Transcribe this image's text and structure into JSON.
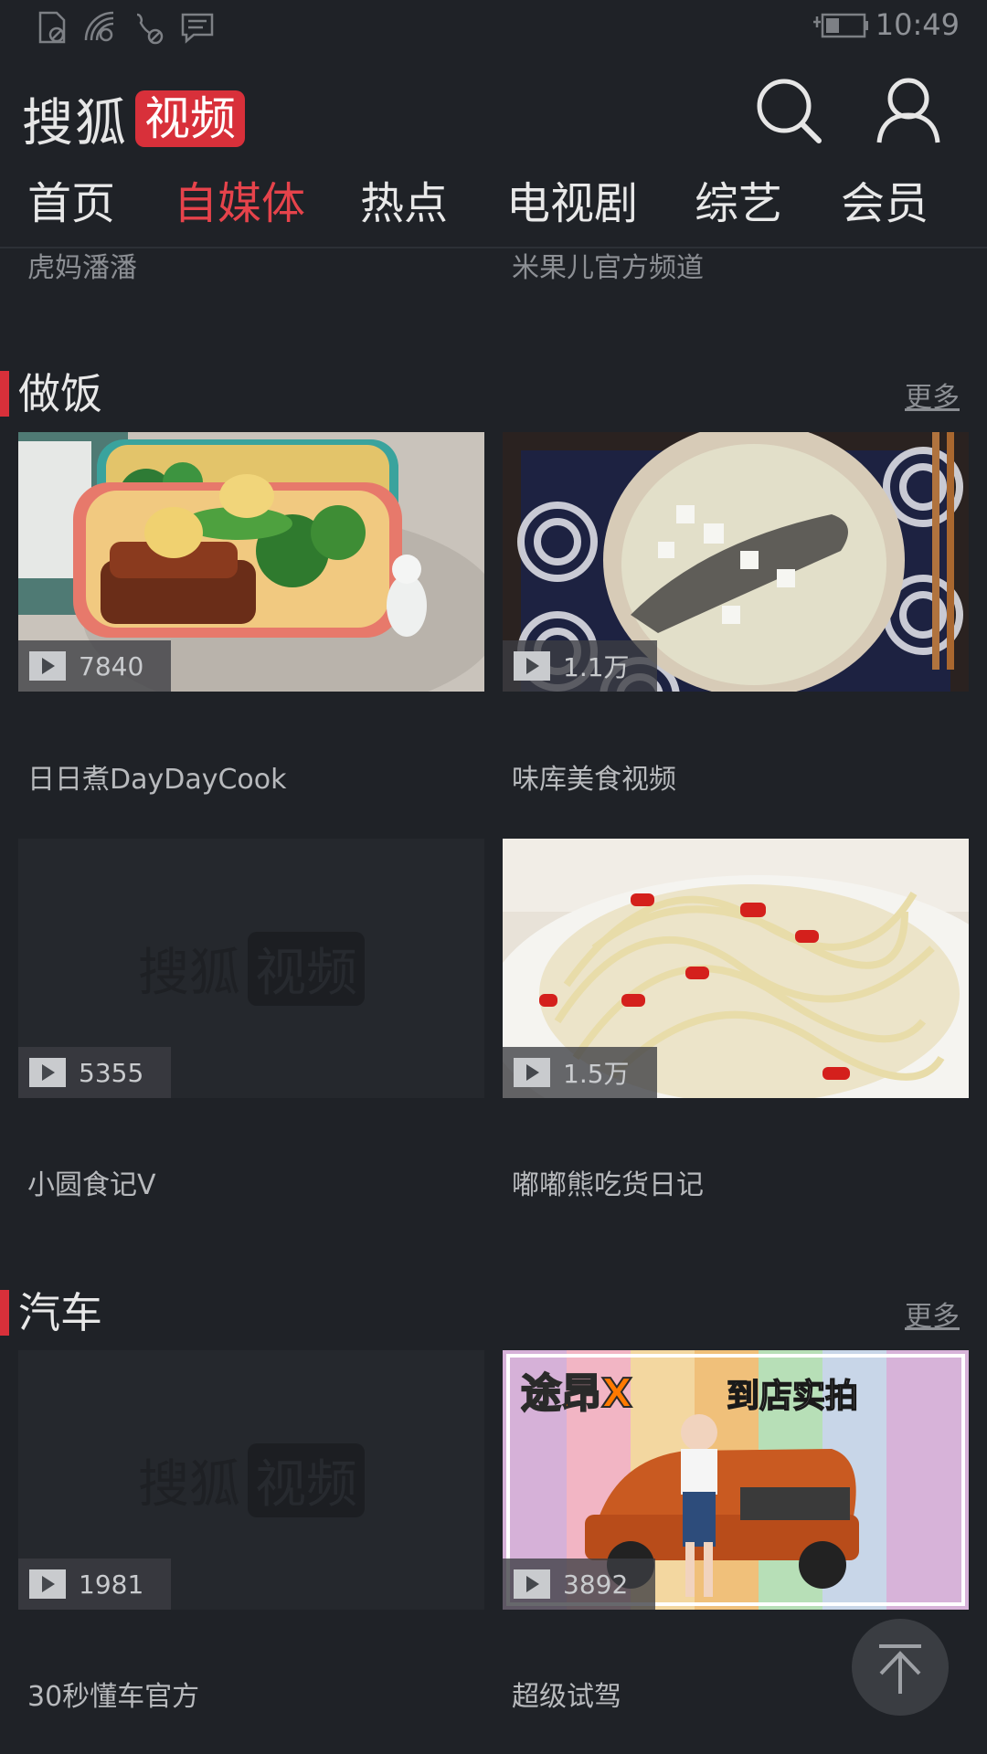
{
  "statusbar": {
    "time": "10:49",
    "icons": [
      "no-sim-icon",
      "wifi-icon",
      "no-call-icon",
      "message-icon"
    ],
    "battery_icon": "battery-charging-icon"
  },
  "header": {
    "logo_main": "搜狐",
    "logo_badge": "视频",
    "search_icon": "search-icon",
    "user_icon": "user-icon"
  },
  "tabs": [
    {
      "label": "首页",
      "active": false
    },
    {
      "label": "自媒体",
      "active": true
    },
    {
      "label": "热点",
      "active": false
    },
    {
      "label": "电视剧",
      "active": false
    },
    {
      "label": "综艺",
      "active": false
    },
    {
      "label": "会员",
      "active": false
    }
  ],
  "top_labels": [
    "虎妈潘潘",
    "米果儿官方频道"
  ],
  "sections": [
    {
      "title": "做饭",
      "more": "更多",
      "items": [
        {
          "label": "日日煮DayDayCook",
          "count": "7840"
        },
        {
          "label": "味库美食视频",
          "count": "1.1万"
        },
        {
          "label": "小圆食记V",
          "count": "5355"
        },
        {
          "label": "嘟嘟熊吃货日记",
          "count": "1.5万"
        }
      ]
    },
    {
      "title": "汽车",
      "more": "更多",
      "items": [
        {
          "label": "30秒懂车官方",
          "count": "1981"
        },
        {
          "label": "超级试驾",
          "count": "3892"
        }
      ]
    }
  ],
  "thumb_text": {
    "car_left": "途昂X",
    "car_right": "到店实拍"
  },
  "placeholder": {
    "main": "搜狐",
    "badge": "视频"
  },
  "colors": {
    "accent": "#d8303a",
    "background": "#1f2227"
  }
}
